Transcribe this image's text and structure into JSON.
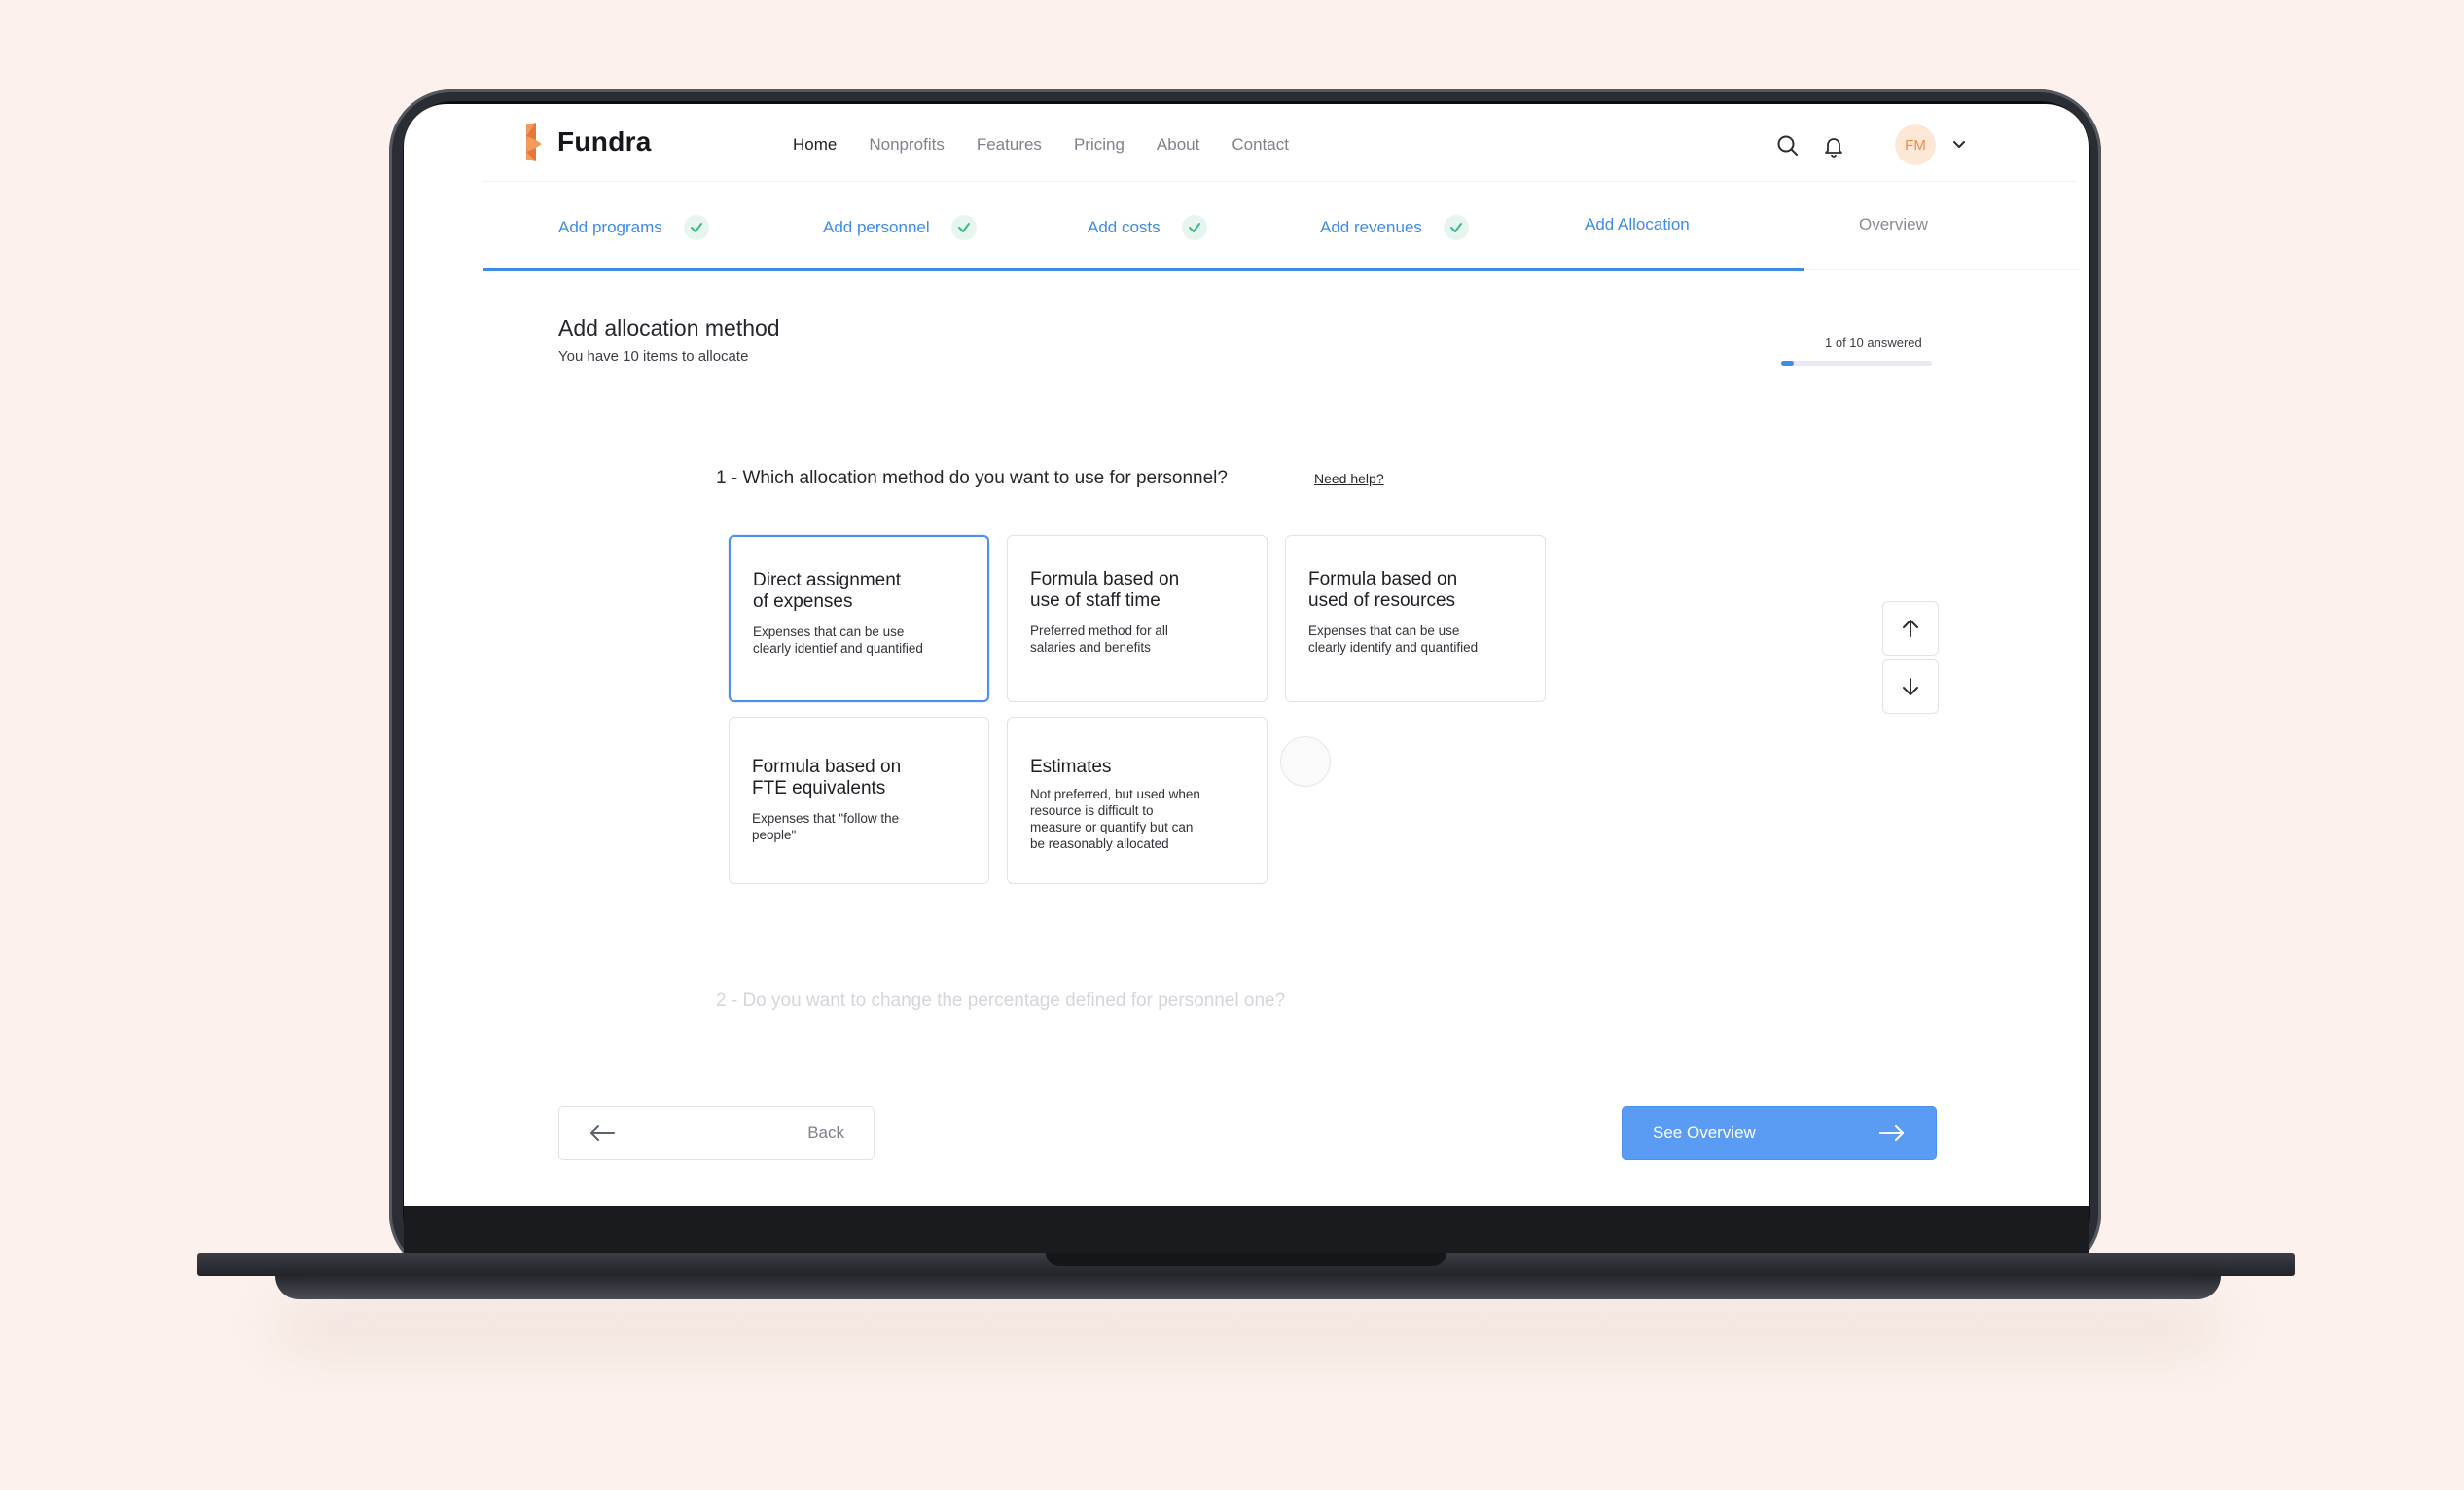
{
  "brand": {
    "name": "Fundra",
    "accent": "#3d8ce6",
    "logo_color": "#ee8b46"
  },
  "nav": {
    "items": [
      "Home",
      "Nonprofits",
      "Features",
      "Pricing",
      "About",
      "Contact"
    ],
    "active": "Home"
  },
  "user": {
    "initials": "FM"
  },
  "steps": [
    {
      "label": "Add programs",
      "done": true
    },
    {
      "label": "Add personnel",
      "done": true
    },
    {
      "label": "Add costs",
      "done": true
    },
    {
      "label": "Add revenues",
      "done": true
    },
    {
      "label": "Add Allocation",
      "done": false
    },
    {
      "label": "Overview",
      "done": false
    }
  ],
  "section": {
    "title": "Add allocation method",
    "subtitle": "You have 10 items to allocate",
    "answered_label": "1 of 10 answered",
    "answered_fraction": 0.1
  },
  "question1": {
    "text": "1 - Which allocation method do you want to use for personnel?",
    "help": "Need help?"
  },
  "options": [
    {
      "title_1": "Direct assignment",
      "title_2": "of expenses",
      "desc_1": "Expenses that can be use",
      "desc_2": "clearly identief and quantified",
      "selected": true
    },
    {
      "title_1": "Formula based on",
      "title_2": "use of staff time",
      "desc_1": "Preferred method for all",
      "desc_2": "salaries and benefits",
      "selected": false
    },
    {
      "title_1": "Formula based on",
      "title_2": "used of resources",
      "desc_1": "Expenses that can be use",
      "desc_2": "clearly identify and quantified",
      "selected": false
    },
    {
      "title_1": "Formula based on",
      "title_2": "FTE equivalents",
      "desc_1": "Expenses that \"follow the",
      "desc_2": "people\"",
      "selected": false
    },
    {
      "title_1": "Estimates",
      "title_2": "",
      "desc_1": "Not preferred, but used when",
      "desc_2": "resource is difficult to",
      "desc_3": "measure or quantify but can",
      "desc_4": "be reasonably allocated",
      "selected": false
    }
  ],
  "question2": {
    "text": "2 - Do you want to change the percentage defined for personnel one?"
  },
  "buttons": {
    "back": "Back",
    "next": "See Overview"
  }
}
